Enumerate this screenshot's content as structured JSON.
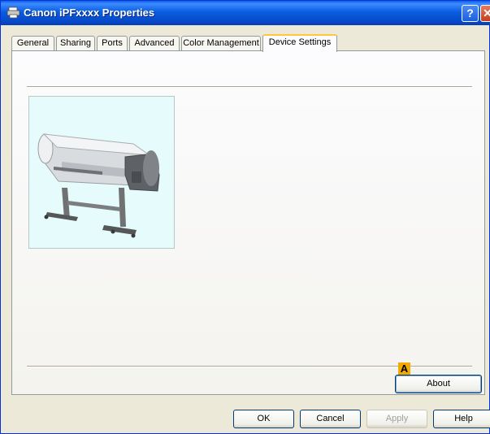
{
  "window": {
    "title": "Canon iPFxxxx Properties"
  },
  "tabs": [
    {
      "label": "General"
    },
    {
      "label": "Sharing"
    },
    {
      "label": "Ports"
    },
    {
      "label": "Advanced"
    },
    {
      "label": "Color Management"
    },
    {
      "label": "Device Settings"
    }
  ],
  "panel": {
    "badge": "A",
    "about_label": "About"
  },
  "footer": {
    "ok_label": "OK",
    "cancel_label": "Cancel",
    "apply_label": "Apply",
    "help_label": "Help"
  },
  "icons": {
    "titlebar_help": "?",
    "titlebar_close": "✕"
  },
  "colors": {
    "titlebar": "#0a5fe6",
    "dialog_bg": "#ece9d8",
    "active_tab_accent": "#ffc83c",
    "badge": "#f2a900",
    "printer_bg": "#e6fbfb"
  }
}
